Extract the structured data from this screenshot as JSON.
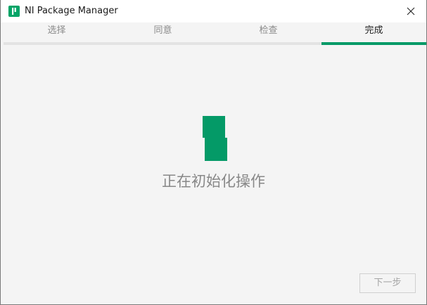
{
  "window": {
    "title": "NI Package Manager"
  },
  "tabs": [
    {
      "label": "选择",
      "active": false
    },
    {
      "label": "同意",
      "active": false
    },
    {
      "label": "检查",
      "active": false
    },
    {
      "label": "完成",
      "active": true
    }
  ],
  "progress": {
    "current_step": 4,
    "total_steps": 4
  },
  "main": {
    "status": "正在初始化操作",
    "spinner_icon": "ni-spinner-icon"
  },
  "footer": {
    "next_label": "下一步",
    "next_enabled": false
  },
  "colors": {
    "accent": "#049a67",
    "track": "#e3e3e3",
    "background": "#f4f4f4"
  }
}
